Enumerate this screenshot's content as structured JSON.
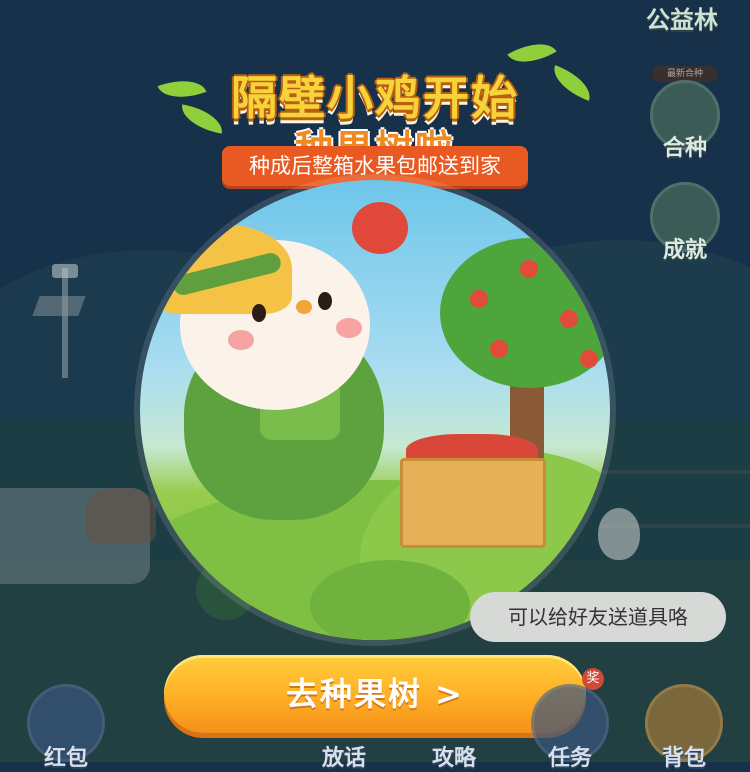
{
  "top_right": {
    "gongyi_label": "公益林",
    "tag_label": "最新合种"
  },
  "side_menu": [
    {
      "key": "heizhong",
      "label": "合种"
    },
    {
      "key": "chengjiu",
      "label": "成就"
    }
  ],
  "popup": {
    "title_line1": "隔壁小鸡开始",
    "title_line2": "种果树啦",
    "subtitle": "种成后整箱水果包邮送到家",
    "cta_label": "去种果树 >"
  },
  "hint_bubble": "可以给好友送道具咯",
  "bottom_bar": [
    {
      "key": "hongbao",
      "label": "红包"
    },
    {
      "key": "fanghua",
      "label": "放话"
    },
    {
      "key": "gonglue",
      "label": "攻略"
    },
    {
      "key": "renwu",
      "label": "任务"
    },
    {
      "key": "beibao",
      "label": "背包"
    }
  ],
  "badge_text": "奖",
  "colors": {
    "cta": "#ffb02a",
    "title_yellow": "#f7d33b",
    "title_orange": "#f08a1f",
    "subtitle_bg": "#e85a22"
  }
}
